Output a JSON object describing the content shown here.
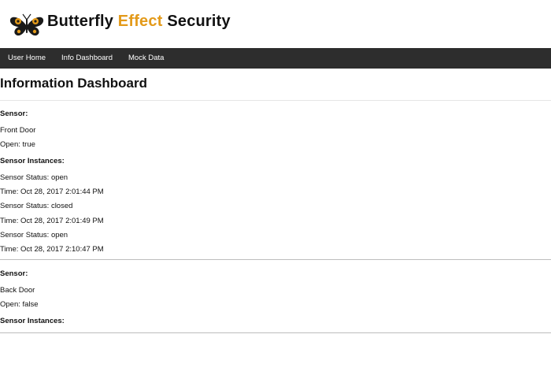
{
  "brand": {
    "name_part1": "Butterfly ",
    "name_accent": "Effect",
    "name_part2": " Security",
    "accent_color": "#e39a1a",
    "logo_icon": "butterfly-icon"
  },
  "nav": {
    "items": [
      {
        "label": "User Home"
      },
      {
        "label": "Info Dashboard"
      },
      {
        "label": "Mock Data"
      }
    ],
    "background": "#2d2d2d"
  },
  "page": {
    "title": "Information Dashboard"
  },
  "sensors": [
    {
      "sensor_label": "Sensor:",
      "name": "Front Door",
      "open_text": "Open: true",
      "instances_label": "Sensor Instances:",
      "instances": [
        {
          "status": "Sensor Status: open",
          "time": "Time: Oct 28, 2017 2:01:44 PM"
        },
        {
          "status": "Sensor Status: closed",
          "time": "Time: Oct 28, 2017 2:01:49 PM"
        },
        {
          "status": "Sensor Status: open",
          "time": "Time: Oct 28, 2017 2:10:47 PM"
        }
      ]
    },
    {
      "sensor_label": "Sensor:",
      "name": "Back Door",
      "open_text": "Open: false",
      "instances_label": "Sensor Instances:",
      "instances": []
    }
  ]
}
